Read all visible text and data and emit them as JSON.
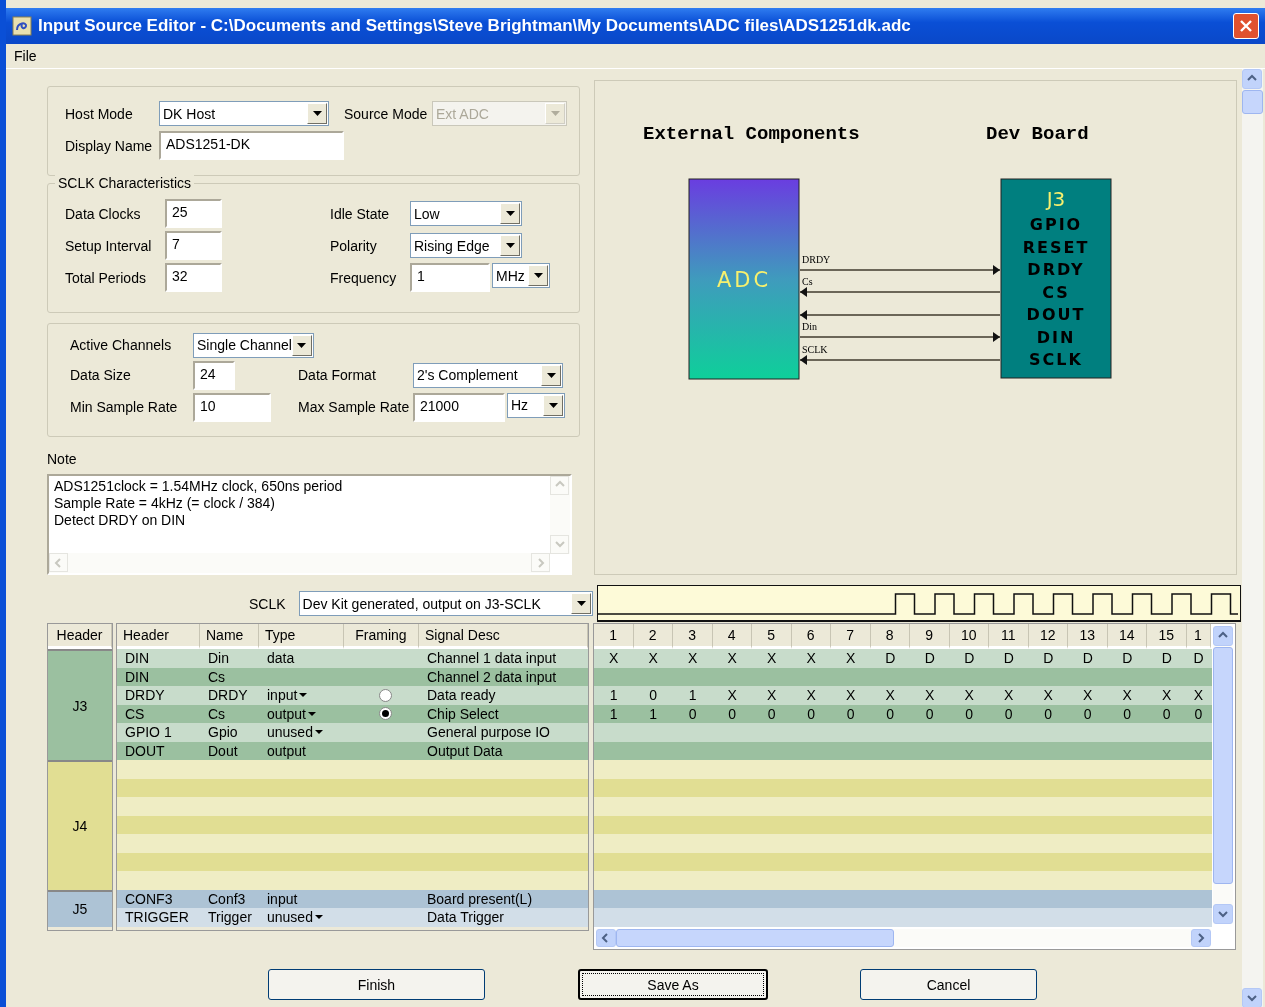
{
  "window": {
    "title": "Input Source Editor - C:\\Documents and Settings\\Steve Brightman\\My Documents\\ADC files\\ADS1251dk.adc"
  },
  "menu": [
    "File"
  ],
  "form_boxes": [
    {
      "rows": [
        [
          {
            "label": "Host Mode",
            "value": "DK Host",
            "kind": "select",
            "disabled": false
          },
          {
            "label": "Source Mode",
            "value": "Ext ADC",
            "kind": "select",
            "disabled": true
          }
        ],
        [
          {
            "label": "Display Name",
            "value": "ADS1251-DK",
            "kind": "text",
            "disabled": false
          }
        ]
      ]
    },
    {
      "title": "SCLK Characteristics",
      "rows": [
        [
          {
            "label": "Data Clocks",
            "value": "25",
            "kind": "text",
            "disabled": false
          },
          {
            "label": "Idle State",
            "value": "Low",
            "kind": "select",
            "disabled": false
          }
        ],
        [
          {
            "label": "Setup Interval",
            "value": "7",
            "kind": "text",
            "disabled": false
          },
          {
            "label": "Polarity",
            "value": "Rising Edge",
            "kind": "select",
            "disabled": false
          }
        ],
        [
          {
            "label": "Total Periods",
            "value": "32",
            "kind": "text",
            "disabled": false
          },
          {
            "label": "Frequency",
            "value": "1",
            "kind": "text",
            "disabled": false,
            "unit": "MHz"
          }
        ]
      ]
    },
    {
      "rows": [
        [
          {
            "label": "Active Channels",
            "value": "Single Channel",
            "kind": "select",
            "disabled": false
          }
        ],
        [
          {
            "label": "Data Size",
            "value": "24",
            "kind": "text",
            "disabled": false
          },
          {
            "label": "Data Format",
            "value": "2's Complement",
            "kind": "select",
            "disabled": false
          }
        ],
        [
          {
            "label": "Min Sample Rate",
            "value": "10",
            "kind": "text",
            "disabled": false
          },
          {
            "label": "Max Sample Rate",
            "value": "21000",
            "kind": "text",
            "disabled": false,
            "unit": "Hz"
          }
        ]
      ]
    }
  ],
  "note": {
    "label": "Note",
    "lines": [
      "ADS1251clock = 1.54MHz clock, 650ns period",
      "Sample Rate = 4kHz (= clock / 384)",
      "Detect DRDY on DIN"
    ]
  },
  "diagram": {
    "left_title": "External Components",
    "right_title": "Dev Board",
    "chip": "ADC",
    "board": {
      "title": "J3",
      "pins": [
        "GPIO",
        "RESET",
        "DRDY",
        "CS",
        "DOUT",
        "DIN",
        "SCLK"
      ]
    },
    "signals": [
      {
        "label": "DRDY",
        "to_board": true
      },
      {
        "label": "Cs",
        "to_board": false
      },
      {
        "to_board": false
      },
      {
        "label": "Din",
        "to_board": true
      },
      {
        "label": "SCLK",
        "to_board": false
      }
    ]
  },
  "sclk": {
    "label": "SCLK",
    "value": "Dev Kit generated, output on J3-SCLK"
  },
  "table": {
    "group_header": "Header",
    "columns": [
      "Header",
      "Name",
      "Type",
      "Framing",
      "Signal Desc"
    ],
    "bit_columns": [
      "1",
      "2",
      "3",
      "4",
      "5",
      "6",
      "7",
      "8",
      "9",
      "10",
      "11",
      "12",
      "13",
      "14",
      "15",
      "1"
    ],
    "groups": [
      {
        "header": "J3",
        "color": "#9bc0a0",
        "rows": [
          {
            "header": "DIN",
            "name": "Din",
            "type": "data",
            "type_menu": false,
            "desc": "Channel 1 data input",
            "bits": [
              "X",
              "X",
              "X",
              "X",
              "X",
              "X",
              "X",
              "D",
              "D",
              "D",
              "D",
              "D",
              "D",
              "D",
              "D",
              "D"
            ]
          },
          {
            "header": "DIN",
            "name": "Cs",
            "desc": "Channel 2 data input"
          },
          {
            "header": "DRDY",
            "name": "DRDY",
            "type": "input",
            "type_menu": true,
            "framing": {
              "selected": false
            },
            "desc": "Data ready",
            "bits": [
              "1",
              "0",
              "1",
              "X",
              "X",
              "X",
              "X",
              "X",
              "X",
              "X",
              "X",
              "X",
              "X",
              "X",
              "X",
              "X"
            ]
          },
          {
            "header": "CS",
            "name": "Cs",
            "type": "output",
            "type_menu": true,
            "framing": {
              "selected": true
            },
            "desc": "Chip Select",
            "bits": [
              "1",
              "1",
              "0",
              "0",
              "0",
              "0",
              "0",
              "0",
              "0",
              "0",
              "0",
              "0",
              "0",
              "0",
              "0",
              "0"
            ]
          },
          {
            "header": "GPIO 1",
            "name": "Gpio",
            "type": "unused",
            "type_menu": true,
            "desc": "General purpose IO"
          },
          {
            "header": "DOUT",
            "name": "Dout",
            "type": "output",
            "type_menu": false,
            "desc": "Output Data"
          }
        ]
      },
      {
        "header": "J4",
        "color": "#e1de93",
        "rows": [
          {},
          {},
          {},
          {},
          {},
          {},
          {}
        ]
      },
      {
        "header": "J5",
        "color": "#adc3d5",
        "rows": [
          {
            "header": "CONF3",
            "name": "Conf3",
            "type": "input",
            "type_menu": false,
            "desc": "Board present(L)"
          },
          {
            "header": "TRIGGER",
            "name": "Trigger",
            "type": "unused",
            "type_menu": true,
            "desc": "Data Trigger"
          }
        ]
      }
    ]
  },
  "buttons": [
    {
      "label": "Finish",
      "default": false
    },
    {
      "label": "Save As",
      "default": true
    },
    {
      "label": "Cancel",
      "default": false
    }
  ]
}
